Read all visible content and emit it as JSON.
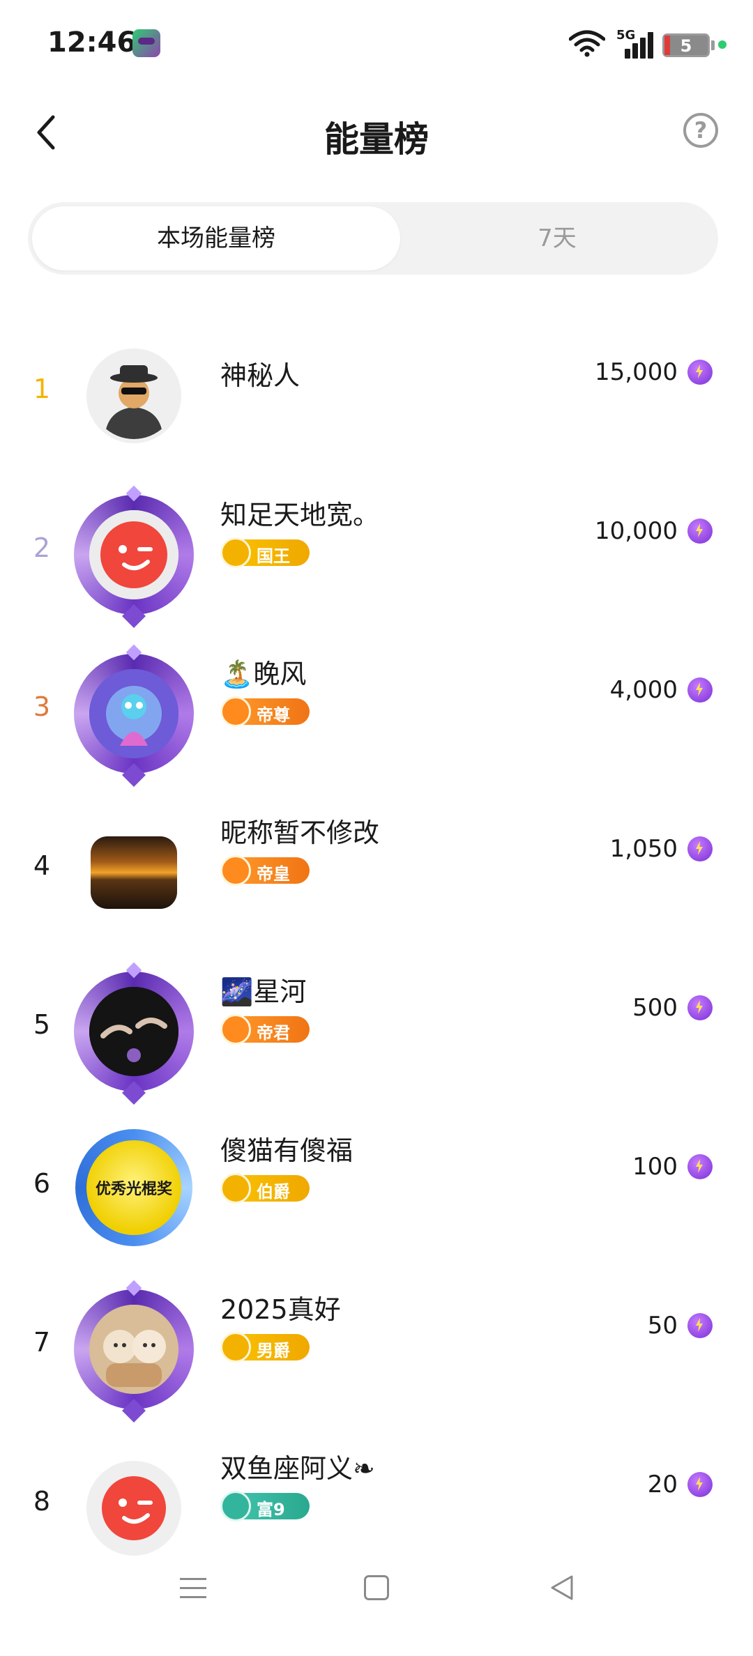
{
  "status_bar": {
    "time": "12:46",
    "network": "5G",
    "battery": "5"
  },
  "header": {
    "title": "能量榜",
    "help_symbol": "?"
  },
  "tabs": [
    {
      "label": "本场能量榜",
      "active": true
    },
    {
      "label": "7天",
      "active": false
    }
  ],
  "ranking": [
    {
      "rank": "1",
      "name": "神秘人",
      "badge": "",
      "score": "15,000",
      "avatar": "mystery-person",
      "frame": "none"
    },
    {
      "rank": "2",
      "name": "知足天地宽。",
      "badge": "国王",
      "badge_color": "gold",
      "score": "10,000",
      "avatar": "red-wink-face",
      "frame": "purple"
    },
    {
      "rank": "3",
      "name": "🏝️晚风",
      "badge": "帝尊",
      "badge_color": "orange",
      "score": "4,000",
      "avatar": "fairy-character",
      "frame": "purple"
    },
    {
      "rank": "4",
      "name": "昵称暂不修改",
      "badge": "帝皇",
      "badge_color": "orange",
      "score": "1,050",
      "avatar": "sunset-lake",
      "frame": "none"
    },
    {
      "rank": "5",
      "name": "🌌星河",
      "badge": "帝君",
      "badge_color": "orange",
      "score": "500",
      "avatar": "dark-hands",
      "frame": "purple"
    },
    {
      "rank": "6",
      "name": "傻猫有傻福",
      "badge": "伯爵",
      "badge_color": "gold",
      "score": "100",
      "avatar": "award-yellow",
      "frame": "blue",
      "avatar_text": "优秀光棍奖"
    },
    {
      "rank": "7",
      "name": "2025真好",
      "badge": "男爵",
      "badge_color": "gold",
      "score": "50",
      "avatar": "plush-dolls",
      "frame": "purple"
    },
    {
      "rank": "8",
      "name": "双鱼座阿义❧",
      "badge": "富9",
      "badge_color": "teal",
      "score": "20",
      "avatar": "red-wink-face",
      "frame": "none"
    }
  ],
  "colors": {
    "rank1": "#f5b400",
    "rank2": "#a9a4d6",
    "rank3": "#e07a3a",
    "energy": "#8b3de0"
  },
  "icons": {
    "back": "chevron-left-icon",
    "help": "question-circle-icon",
    "energy": "lightning-icon"
  }
}
